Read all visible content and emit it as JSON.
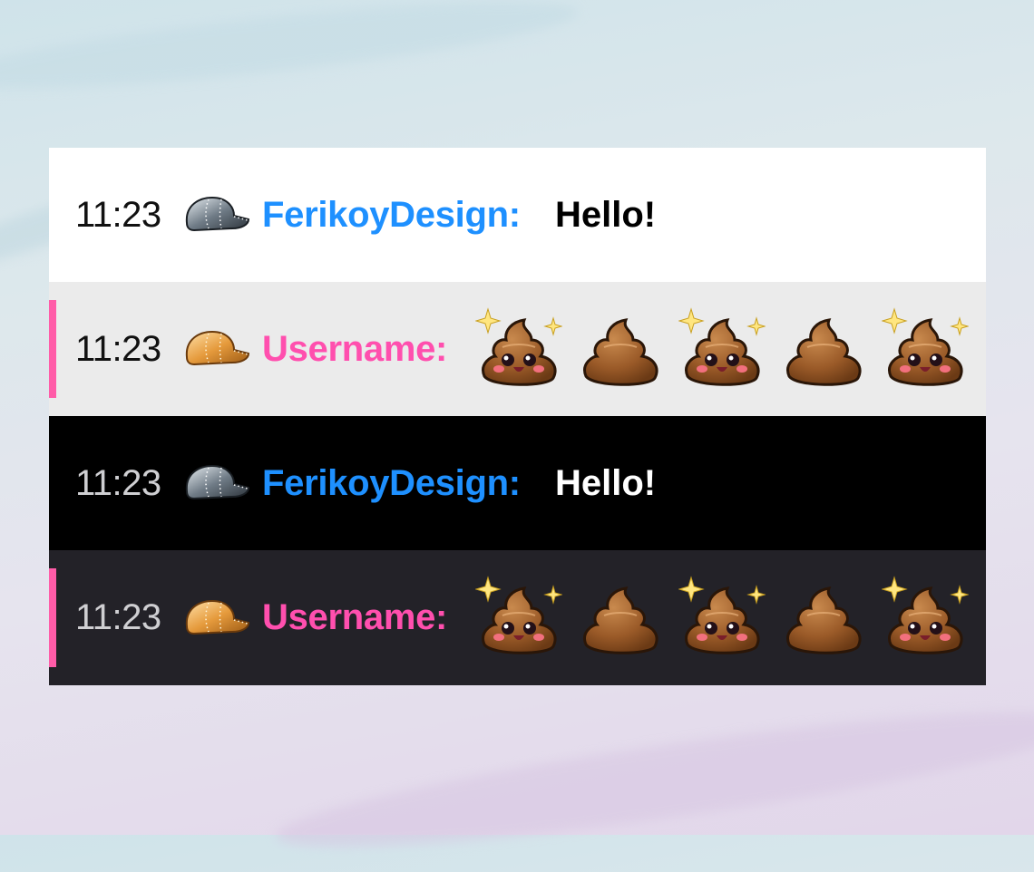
{
  "rows": [
    {
      "theme": "light",
      "time": "11:23",
      "badge": "silver-cap-badge-icon",
      "username": "FerikoyDesign:",
      "username_color": "#1e90ff",
      "message": "Hello!"
    },
    {
      "theme": "light-gray",
      "time": "11:23",
      "badge": "gold-cap-badge-icon",
      "username": "Username:",
      "username_color": "#ff4fae",
      "emotes": [
        "poop-sparkle-emote-icon",
        "poop-plain-emote-icon",
        "poop-sparkle-emote-icon",
        "poop-plain-emote-icon",
        "poop-sparkle-emote-icon"
      ]
    },
    {
      "theme": "dark",
      "time": "11:23",
      "badge": "silver-cap-badge-icon",
      "username": "FerikoyDesign:",
      "username_color": "#1e90ff",
      "message": "Hello!"
    },
    {
      "theme": "dark-gray",
      "time": "11:23",
      "badge": "gold-cap-badge-icon",
      "username": "Username:",
      "username_color": "#ff4fae",
      "emotes": [
        "poop-sparkle-emote-icon",
        "poop-plain-emote-icon",
        "poop-sparkle-emote-icon",
        "poop-plain-emote-icon",
        "poop-sparkle-emote-icon"
      ]
    }
  ],
  "highlight_color": "#ff5ca8"
}
